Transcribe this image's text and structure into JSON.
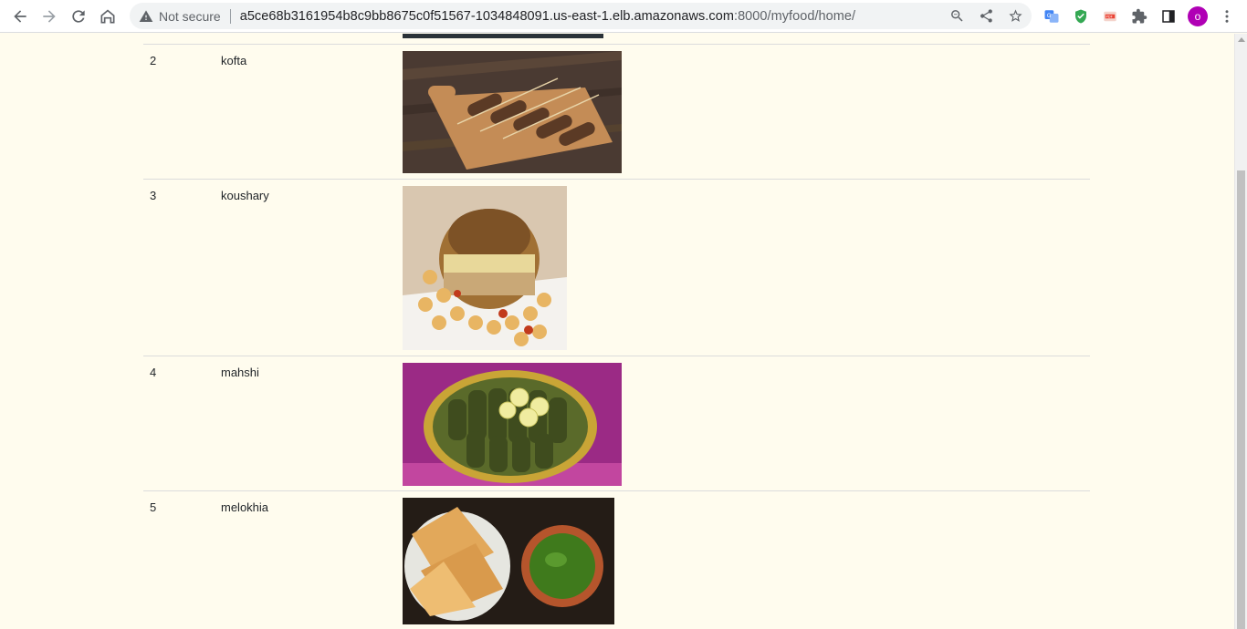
{
  "browser": {
    "security_label": "Not secure",
    "url_host": "a5ce68b3161954b8c9bb8675c0f51567-1034848091.us-east-1.elb.amazonaws.com",
    "url_path": ":8000/myfood/home/",
    "profile_initial": "o",
    "profile_color": "#b000b5"
  },
  "foods": [
    {
      "id": "2",
      "name": "kofta",
      "image_icon": "kofta-photo"
    },
    {
      "id": "3",
      "name": "koushary",
      "image_icon": "koushary-photo"
    },
    {
      "id": "4",
      "name": "mahshi",
      "image_icon": "mahshi-photo"
    },
    {
      "id": "5",
      "name": "melokhia",
      "image_icon": "melokhia-photo"
    }
  ],
  "colors": {
    "page_background": "#fffcee",
    "row_border": "#dcdcdc"
  }
}
